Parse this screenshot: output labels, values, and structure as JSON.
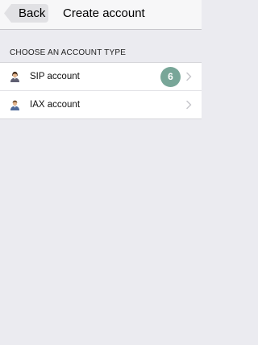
{
  "navbar": {
    "back_label": "Back",
    "title": "Create account"
  },
  "section": {
    "header": "CHOOSE AN ACCOUNT TYPE"
  },
  "account_types": [
    {
      "label": "SIP account",
      "icon": "user-icon",
      "badge": "6"
    },
    {
      "label": "IAX account",
      "icon": "user-icon"
    }
  ],
  "colors": {
    "background": "#ebebf0",
    "badge": "#78a698"
  }
}
